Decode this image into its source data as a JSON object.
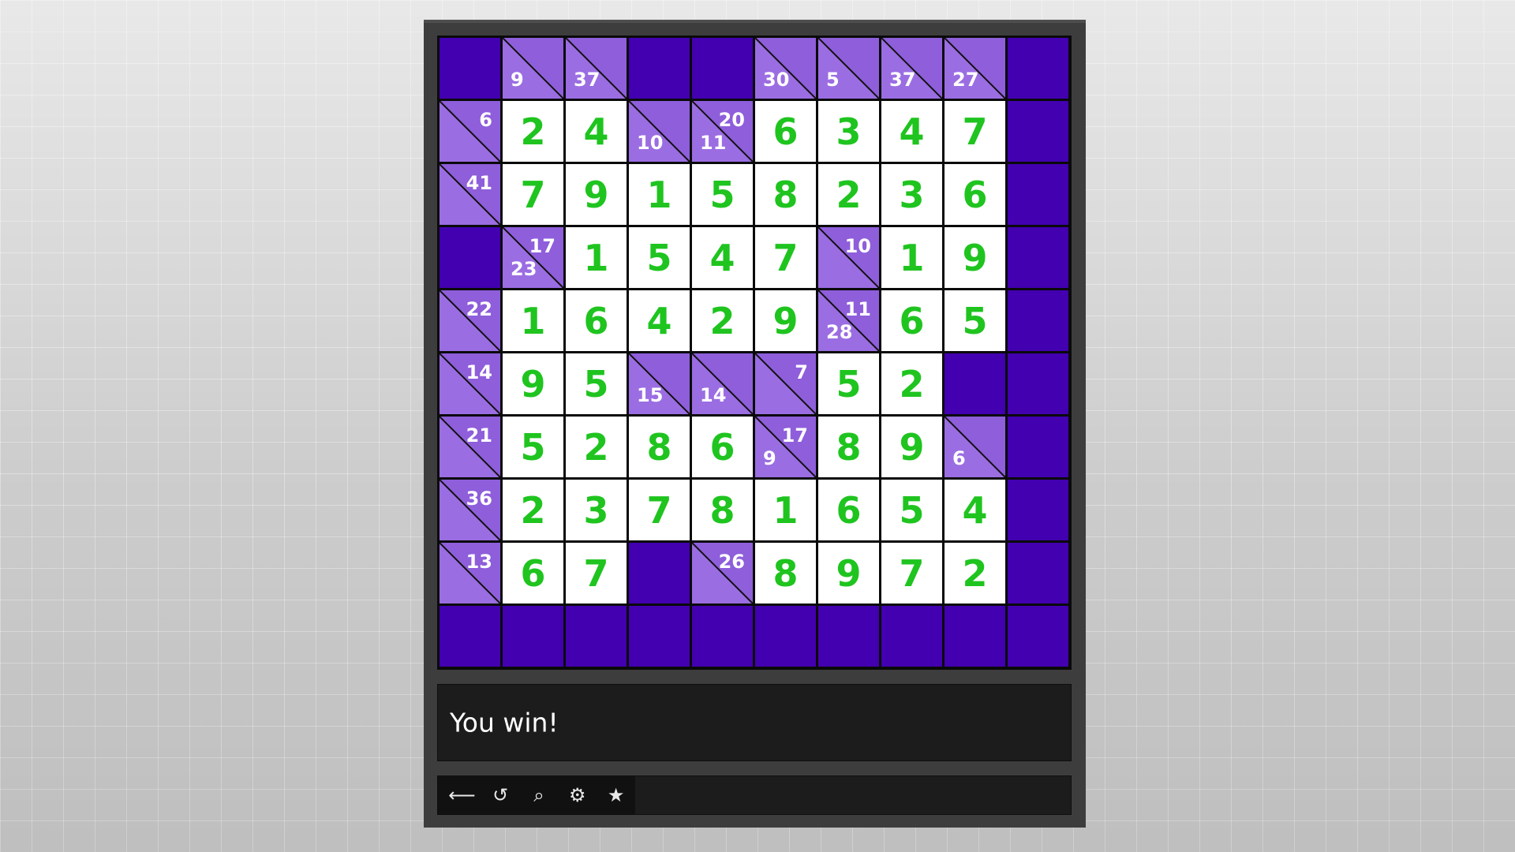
{
  "puzzle": {
    "rows": 10,
    "cols": 10,
    "grid": [
      [
        {
          "t": "b"
        },
        {
          "t": "c",
          "d": "9"
        },
        {
          "t": "c",
          "d": "37"
        },
        {
          "t": "b"
        },
        {
          "t": "b"
        },
        {
          "t": "c",
          "d": "30"
        },
        {
          "t": "c",
          "d": "5"
        },
        {
          "t": "c",
          "d": "37"
        },
        {
          "t": "c",
          "d": "27"
        },
        {
          "t": "b"
        }
      ],
      [
        {
          "t": "c",
          "r": "6"
        },
        {
          "t": "v",
          "v": "2"
        },
        {
          "t": "v",
          "v": "4"
        },
        {
          "t": "c",
          "d": "10"
        },
        {
          "t": "c",
          "r": "20",
          "d": "11"
        },
        {
          "t": "v",
          "v": "6"
        },
        {
          "t": "v",
          "v": "3"
        },
        {
          "t": "v",
          "v": "4"
        },
        {
          "t": "v",
          "v": "7"
        },
        {
          "t": "b"
        }
      ],
      [
        {
          "t": "c",
          "r": "41"
        },
        {
          "t": "v",
          "v": "7"
        },
        {
          "t": "v",
          "v": "9"
        },
        {
          "t": "v",
          "v": "1"
        },
        {
          "t": "v",
          "v": "5"
        },
        {
          "t": "v",
          "v": "8"
        },
        {
          "t": "v",
          "v": "2"
        },
        {
          "t": "v",
          "v": "3"
        },
        {
          "t": "v",
          "v": "6"
        },
        {
          "t": "b"
        }
      ],
      [
        {
          "t": "b"
        },
        {
          "t": "c",
          "r": "17",
          "d": "23"
        },
        {
          "t": "v",
          "v": "1"
        },
        {
          "t": "v",
          "v": "5"
        },
        {
          "t": "v",
          "v": "4"
        },
        {
          "t": "v",
          "v": "7"
        },
        {
          "t": "c",
          "r": "10"
        },
        {
          "t": "v",
          "v": "1"
        },
        {
          "t": "v",
          "v": "9"
        },
        {
          "t": "b"
        }
      ],
      [
        {
          "t": "c",
          "r": "22"
        },
        {
          "t": "v",
          "v": "1"
        },
        {
          "t": "v",
          "v": "6"
        },
        {
          "t": "v",
          "v": "4"
        },
        {
          "t": "v",
          "v": "2"
        },
        {
          "t": "v",
          "v": "9"
        },
        {
          "t": "c",
          "r": "11",
          "d": "28"
        },
        {
          "t": "v",
          "v": "6"
        },
        {
          "t": "v",
          "v": "5"
        },
        {
          "t": "b"
        }
      ],
      [
        {
          "t": "c",
          "r": "14"
        },
        {
          "t": "v",
          "v": "9"
        },
        {
          "t": "v",
          "v": "5"
        },
        {
          "t": "c",
          "d": "15"
        },
        {
          "t": "c",
          "d": "14"
        },
        {
          "t": "c",
          "r": "7"
        },
        {
          "t": "v",
          "v": "5"
        },
        {
          "t": "v",
          "v": "2"
        },
        {
          "t": "b"
        },
        {
          "t": "b"
        }
      ],
      [
        {
          "t": "c",
          "r": "21"
        },
        {
          "t": "v",
          "v": "5"
        },
        {
          "t": "v",
          "v": "2"
        },
        {
          "t": "v",
          "v": "8"
        },
        {
          "t": "v",
          "v": "6"
        },
        {
          "t": "c",
          "r": "17",
          "d": "9"
        },
        {
          "t": "v",
          "v": "8"
        },
        {
          "t": "v",
          "v": "9"
        },
        {
          "t": "c",
          "d": "6"
        },
        {
          "t": "b"
        }
      ],
      [
        {
          "t": "c",
          "r": "36"
        },
        {
          "t": "v",
          "v": "2"
        },
        {
          "t": "v",
          "v": "3"
        },
        {
          "t": "v",
          "v": "7"
        },
        {
          "t": "v",
          "v": "8"
        },
        {
          "t": "v",
          "v": "1"
        },
        {
          "t": "v",
          "v": "6"
        },
        {
          "t": "v",
          "v": "5"
        },
        {
          "t": "v",
          "v": "4"
        },
        {
          "t": "b"
        }
      ],
      [
        {
          "t": "c",
          "r": "13"
        },
        {
          "t": "v",
          "v": "6"
        },
        {
          "t": "v",
          "v": "7"
        },
        {
          "t": "b"
        },
        {
          "t": "c",
          "r": "26"
        },
        {
          "t": "v",
          "v": "8"
        },
        {
          "t": "v",
          "v": "9"
        },
        {
          "t": "v",
          "v": "7"
        },
        {
          "t": "v",
          "v": "2"
        },
        {
          "t": "b"
        }
      ],
      [
        {
          "t": "b"
        },
        {
          "t": "b"
        },
        {
          "t": "b"
        },
        {
          "t": "b"
        },
        {
          "t": "b"
        },
        {
          "t": "b"
        },
        {
          "t": "b"
        },
        {
          "t": "b"
        },
        {
          "t": "b"
        },
        {
          "t": "b"
        }
      ]
    ]
  },
  "status": {
    "message": "You win!"
  },
  "toolbar": {
    "buttons": [
      {
        "name": "back-button",
        "icon": "left-arrow-icon",
        "glyph": "⟵"
      },
      {
        "name": "restart-button",
        "icon": "undo-icon",
        "glyph": "↺"
      },
      {
        "name": "search-button",
        "icon": "search-icon",
        "glyph": "⌕"
      },
      {
        "name": "settings-button",
        "icon": "gear-icon",
        "glyph": "⚙"
      },
      {
        "name": "favorite-button",
        "icon": "star-icon",
        "glyph": "★"
      }
    ]
  },
  "colors": {
    "block": "#4200b0",
    "clue": "#8e5edb",
    "white": "#ffffff",
    "value": "#1fc41f",
    "panel": "#1c1c1c"
  }
}
